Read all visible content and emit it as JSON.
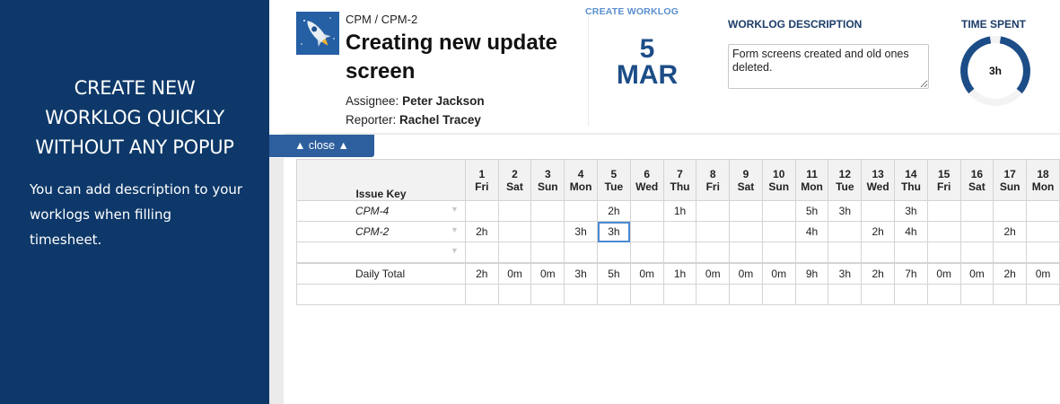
{
  "promo": {
    "title_lines": [
      "CREATE NEW",
      "WORKLOG QUICKLY",
      "WITHOUT ANY POPUP"
    ],
    "description": "You can add description to your worklogs when filling timesheet."
  },
  "issue": {
    "breadcrumb": "CPM / CPM-2",
    "title": "Creating new update screen",
    "assignee_label": "Assignee:",
    "assignee": "Peter Jackson",
    "reporter_label": "Reporter:",
    "reporter": "Rachel Tracey",
    "project_icon": "rocket-icon"
  },
  "create_worklog": {
    "label": "CREATE WORKLOG",
    "day": "5",
    "month": "MAR"
  },
  "worklog_description": {
    "label": "WORKLOG DESCRIPTION",
    "value": "Form screens created and old ones deleted."
  },
  "time_spent": {
    "label": "TIME SPENT",
    "value": "3h"
  },
  "close_button": "▲ close ▲",
  "grid": {
    "key_header": "Issue Key",
    "days": [
      {
        "num": "1",
        "dow": "Fri"
      },
      {
        "num": "2",
        "dow": "Sat"
      },
      {
        "num": "3",
        "dow": "Sun"
      },
      {
        "num": "4",
        "dow": "Mon"
      },
      {
        "num": "5",
        "dow": "Tue"
      },
      {
        "num": "6",
        "dow": "Wed"
      },
      {
        "num": "7",
        "dow": "Thu"
      },
      {
        "num": "8",
        "dow": "Fri"
      },
      {
        "num": "9",
        "dow": "Sat"
      },
      {
        "num": "10",
        "dow": "Sun"
      },
      {
        "num": "11",
        "dow": "Mon"
      },
      {
        "num": "12",
        "dow": "Tue"
      },
      {
        "num": "13",
        "dow": "Wed"
      },
      {
        "num": "14",
        "dow": "Thu"
      },
      {
        "num": "15",
        "dow": "Fri"
      },
      {
        "num": "16",
        "dow": "Sat"
      },
      {
        "num": "17",
        "dow": "Sun"
      },
      {
        "num": "18",
        "dow": "Mon"
      }
    ],
    "rows": [
      {
        "key": "CPM-4",
        "values": [
          "",
          "",
          "",
          "",
          "2h",
          "",
          "1h",
          "",
          "",
          "",
          "5h",
          "3h",
          "",
          "3h",
          "",
          "",
          "",
          ""
        ]
      },
      {
        "key": "CPM-2",
        "values": [
          "2h",
          "",
          "",
          "3h",
          "3h",
          "",
          "",
          "",
          "",
          "",
          "4h",
          "",
          "2h",
          "4h",
          "",
          "",
          "2h",
          ""
        ]
      },
      {
        "key": "",
        "values": [
          "",
          "",
          "",
          "",
          "",
          "",
          "",
          "",
          "",
          "",
          "",
          "",
          "",
          "",
          "",
          "",
          "",
          ""
        ]
      }
    ],
    "total_label": "Daily Total",
    "totals": [
      "2h",
      "0m",
      "0m",
      "3h",
      "5h",
      "0m",
      "1h",
      "0m",
      "0m",
      "0m",
      "9h",
      "3h",
      "2h",
      "7h",
      "0m",
      "0m",
      "2h",
      "0m"
    ],
    "selected": {
      "row": 1,
      "col": 4
    }
  },
  "colors": {
    "sidebar_bg": "#0d3869",
    "accent_blue": "#1c4d87",
    "close_tab": "#2d5f9e",
    "selection": "#4a8ad0"
  }
}
